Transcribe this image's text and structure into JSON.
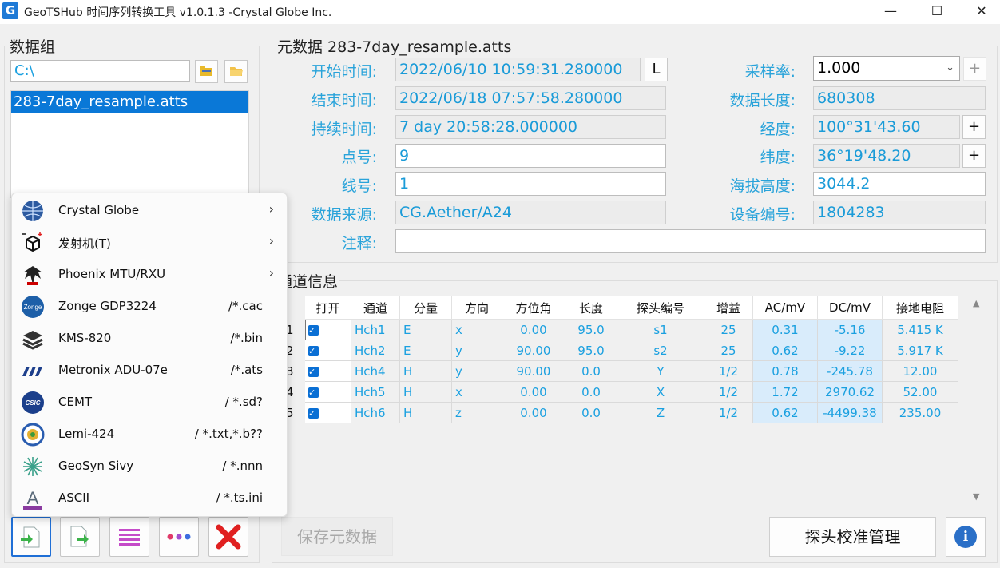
{
  "window": {
    "title": "GeoTSHub 时间序列转换工具 v1.0.1.3 -Crystal Globe Inc.",
    "icon_letter": "G",
    "minimize": "—",
    "maximize": "☐",
    "close": "✕"
  },
  "data_group": {
    "title": "数据组",
    "path_value": "C:\\",
    "files": [
      "283-7day_resample.atts"
    ]
  },
  "import_menu": {
    "items": [
      {
        "label": "Crystal Globe",
        "ext": "",
        "submenu": true,
        "icon": "globe-icon"
      },
      {
        "label": "发射机(T)",
        "ext": "",
        "submenu": true,
        "icon": "transmitter-cube-icon"
      },
      {
        "label": "Phoenix MTU/RXU",
        "ext": "",
        "submenu": true,
        "icon": "phoenix-logo-icon"
      },
      {
        "label": "Zonge GDP3224",
        "ext": "/*.cac",
        "submenu": false,
        "icon": "zonge-logo-icon"
      },
      {
        "label": "KMS-820",
        "ext": "/*.bin",
        "submenu": false,
        "icon": "kms-layers-icon"
      },
      {
        "label": "Metronix ADU-07e",
        "ext": "/*.ats",
        "submenu": false,
        "icon": "metronix-logo-icon"
      },
      {
        "label": "CEMT",
        "ext": "/ *.sd?",
        "submenu": false,
        "icon": "csic-logo-icon"
      },
      {
        "label": "Lemi-424",
        "ext": "/ *.txt,*.b??",
        "submenu": false,
        "icon": "lemi-logo-icon"
      },
      {
        "label": "GeoSyn Sivy",
        "ext": "/ *.nnn",
        "submenu": false,
        "icon": "geosyn-logo-icon"
      },
      {
        "label": "ASCII",
        "ext": "/ *.ts.ini",
        "submenu": false,
        "icon": "ascii-letter-icon"
      }
    ],
    "arrow": "›"
  },
  "metadata": {
    "title": "元数据 283-7day_resample.atts",
    "labels": {
      "start": "开始时间:",
      "end": "结束时间:",
      "duration": "持续时间:",
      "point": "点号:",
      "line": "线号:",
      "source": "数据来源:",
      "note": "注释:",
      "rate": "采样率:",
      "length": "数据长度:",
      "lon": "经度:",
      "lat": "纬度:",
      "elev": "海拔高度:",
      "device": "设备编号:"
    },
    "values": {
      "start": "2022/06/10 10:59:31.280000",
      "end": "2022/06/18 07:57:58.280000",
      "duration": "7 day 20:58:28.000000",
      "point": "9",
      "line": "1",
      "source": "CG.Aether/A24",
      "note": "",
      "rate": "1.000",
      "length": "680308",
      "lon": "100°31'43.60",
      "lat": "36°19'48.20",
      "elev": "3044.2",
      "device": "1804283"
    },
    "l_button": "L",
    "plus": "+"
  },
  "channels": {
    "title": "通道信息",
    "headers": [
      "打开",
      "通道",
      "分量",
      "方向",
      "方位角",
      "长度",
      "探头编号",
      "增益",
      "AC/mV",
      "DC/mV",
      "接地电阻"
    ],
    "rows": [
      {
        "n": "1",
        "ch": "Hch1",
        "comp": "E",
        "dir": "x",
        "az": "0.00",
        "len": "95.0",
        "probe": "s1",
        "gain": "25",
        "ac": "0.31",
        "dc": "-5.16",
        "res": "5.415 K"
      },
      {
        "n": "2",
        "ch": "Hch2",
        "comp": "E",
        "dir": "y",
        "az": "90.00",
        "len": "95.0",
        "probe": "s2",
        "gain": "25",
        "ac": "0.62",
        "dc": "-9.22",
        "res": "5.917 K"
      },
      {
        "n": "3",
        "ch": "Hch4",
        "comp": "H",
        "dir": "y",
        "az": "90.00",
        "len": "0.0",
        "probe": "Y",
        "gain": "1/2",
        "ac": "0.78",
        "dc": "-245.78",
        "res": "12.00"
      },
      {
        "n": "4",
        "ch": "Hch5",
        "comp": "H",
        "dir": "x",
        "az": "0.00",
        "len": "0.0",
        "probe": "X",
        "gain": "1/2",
        "ac": "1.72",
        "dc": "2970.62",
        "res": "52.00"
      },
      {
        "n": "5",
        "ch": "Hch6",
        "comp": "H",
        "dir": "z",
        "az": "0.00",
        "len": "0.0",
        "probe": "Z",
        "gain": "1/2",
        "ac": "0.62",
        "dc": "-4499.38",
        "res": "235.00"
      }
    ]
  },
  "buttons": {
    "save_meta": "保存元数据",
    "probe_calib": "探头校准管理",
    "info": "i"
  },
  "colors": {
    "accent": "#0a78d7",
    "value_text": "#1aa0e0",
    "label_text": "#29a3da"
  }
}
